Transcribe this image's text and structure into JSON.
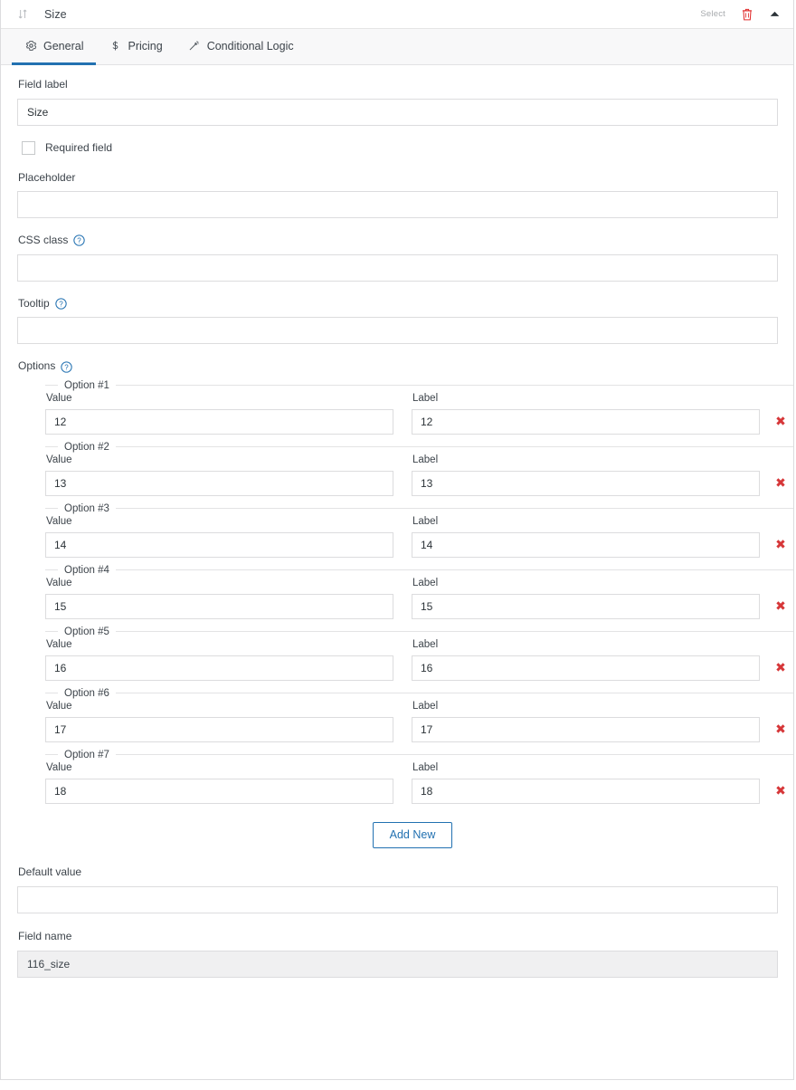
{
  "header": {
    "drag_icon": "sort-handle-icon",
    "title": "Size",
    "select_label": "Select",
    "delete_icon": "trash-icon",
    "collapse_icon": "caret-up-icon"
  },
  "tabs": [
    {
      "label": "General",
      "icon": "gear-icon",
      "active": true
    },
    {
      "label": "Pricing",
      "icon": "dollar-icon",
      "active": false
    },
    {
      "label": "Conditional Logic",
      "icon": "magic-wand-icon",
      "active": false
    }
  ],
  "general": {
    "field_label": {
      "label": "Field label",
      "value": "Size",
      "placeholder": ""
    },
    "required_field": {
      "label": "Required field",
      "checked": false
    },
    "placeholder_field": {
      "label": "Placeholder",
      "value": "",
      "placeholder": ""
    },
    "css_class": {
      "label": "CSS class",
      "value": "",
      "placeholder": "",
      "help_icon": "help-circle-icon"
    },
    "tooltip": {
      "label": "Tooltip",
      "value": "",
      "placeholder": "",
      "help_icon": "help-circle-icon"
    },
    "options": {
      "label": "Options",
      "help_icon": "help-circle-icon",
      "value_label": "Value",
      "label_label": "Label",
      "remove_icon": "✖",
      "add_new_label": "Add New",
      "items": [
        {
          "legend": "Option #1",
          "value": "12",
          "label": "12"
        },
        {
          "legend": "Option #2",
          "value": "13",
          "label": "13"
        },
        {
          "legend": "Option #3",
          "value": "14",
          "label": "14"
        },
        {
          "legend": "Option #4",
          "value": "15",
          "label": "15"
        },
        {
          "legend": "Option #5",
          "value": "16",
          "label": "16"
        },
        {
          "legend": "Option #6",
          "value": "17",
          "label": "17"
        },
        {
          "legend": "Option #7",
          "value": "18",
          "label": "18"
        }
      ]
    },
    "default_value": {
      "label": "Default value",
      "value": "",
      "placeholder": ""
    },
    "field_name": {
      "label": "Field name",
      "value": "116_size",
      "readonly": true
    }
  },
  "colors": {
    "accent_blue": "#2271b1",
    "danger_red": "#d63638",
    "text": "#3c434a",
    "border": "#dcdcde",
    "tab_bg": "#f8f8f9",
    "readonly_bg": "#f0f0f1"
  }
}
